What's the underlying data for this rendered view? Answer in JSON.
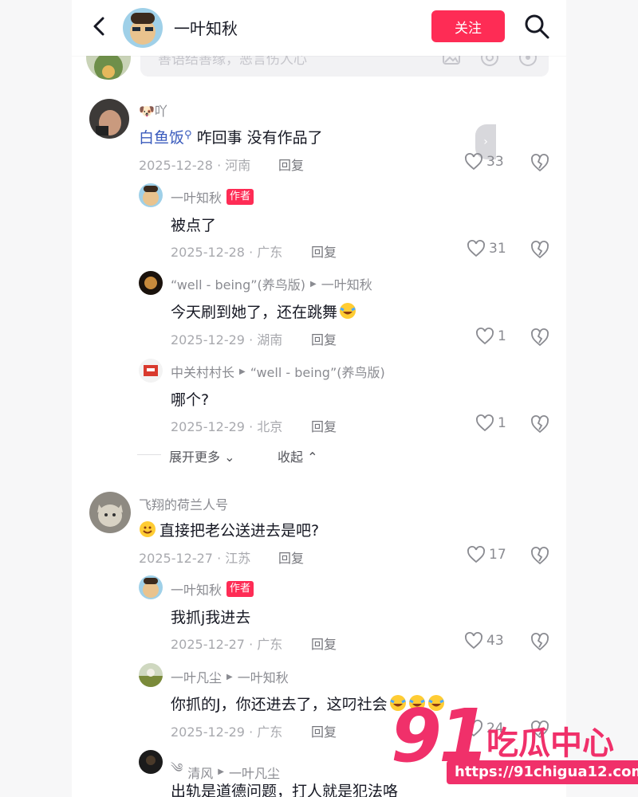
{
  "header": {
    "title": "一叶知秋",
    "follow_label": "关注"
  },
  "input": {
    "placeholder": "善语结善缘，恶言伤人心"
  },
  "comments": [
    {
      "user": "🐶吖",
      "mention": "白鱼饭",
      "text": "咋回事 没有作品了",
      "meta": "2025-12-28 · 河南",
      "reply": "回复",
      "likes": "33"
    },
    {
      "user": "一叶知秋",
      "tag": "作者",
      "text": "被点了",
      "meta": "2025-12-28 · 广东",
      "reply": "回复",
      "likes": "31"
    },
    {
      "user": "“well - being”(养鸟版)",
      "reply_to": "一叶知秋",
      "text": "今天刷到她了，还在跳舞",
      "meta": "2025-12-29 · 湖南",
      "reply": "回复",
      "likes": "1"
    },
    {
      "user": "中关村村长",
      "reply_to": "“well - being”(养鸟版)",
      "text": "哪个?",
      "meta": "2025-12-29 · 北京",
      "reply": "回复",
      "likes": "1"
    },
    {
      "user": "飞翔的荷兰人号",
      "text": "直接把老公送进去是吧?",
      "meta": "2025-12-27 · 江苏",
      "reply": "回复",
      "likes": "17"
    },
    {
      "user": "一叶知秋",
      "tag": "作者",
      "text": "我抓j我进去",
      "meta": "2025-12-27 · 广东",
      "reply": "回复",
      "likes": "43"
    },
    {
      "user": "一叶凡尘",
      "reply_to": "一叶知秋",
      "text": "你抓的J，你还进去了，这叼社会",
      "meta": "2025-12-29 · 广东",
      "reply": "回复",
      "likes": "24"
    },
    {
      "user": "清风",
      "reply_to": "一叶凡尘",
      "text": "出轨是道德问题，打人就是犯法咯"
    }
  ],
  "thread": {
    "expand_label": "展开更多",
    "collapse_label": "收起"
  },
  "watermark": {
    "number": "91",
    "brand": "吃瓜中心",
    "url": "https://91chigua12.com"
  },
  "colors": {
    "accent": "#fe2c55",
    "mention": "#3a5bbd",
    "watermark": "#f0306a"
  }
}
